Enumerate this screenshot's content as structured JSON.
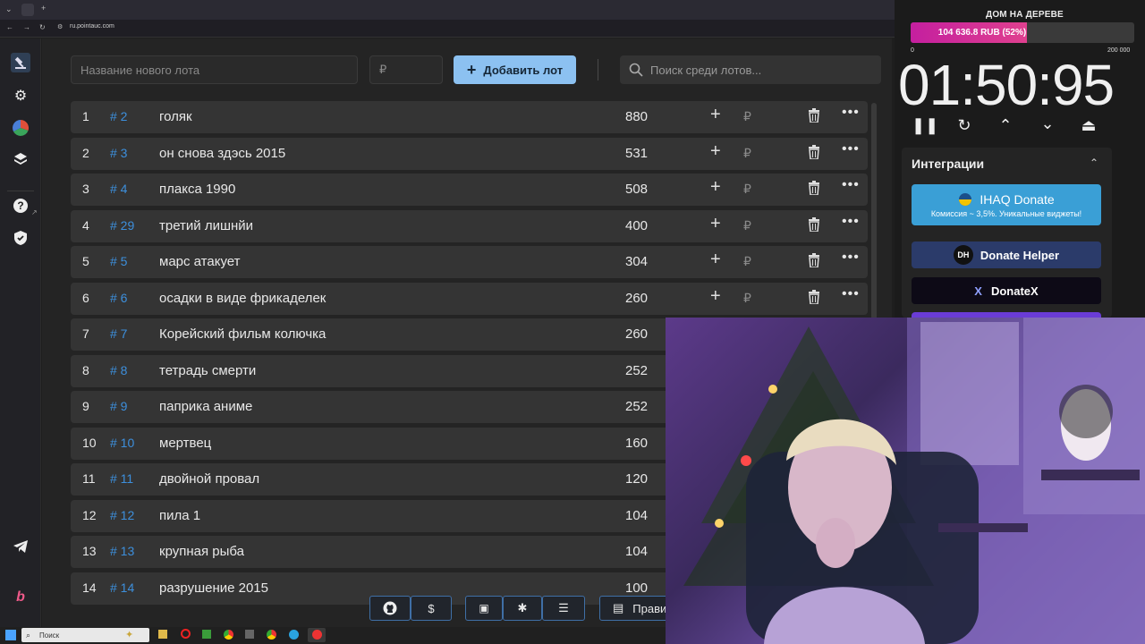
{
  "browser": {
    "url": "ru.pointauc.com"
  },
  "toolbar": {
    "new_lot_placeholder": "Название нового лота",
    "amount_placeholder": "₽",
    "add_button": "Добавить лот",
    "search_placeholder": "Поиск среди лотов..."
  },
  "lots": [
    {
      "n": "1",
      "id": "# 2",
      "name": "голяк",
      "amount": "880"
    },
    {
      "n": "2",
      "id": "# 3",
      "name": "он снова здэсь 2015",
      "amount": "531"
    },
    {
      "n": "3",
      "id": "# 4",
      "name": "плакса 1990",
      "amount": "508"
    },
    {
      "n": "4",
      "id": "# 29",
      "name": "третий лишнйи",
      "amount": "400"
    },
    {
      "n": "5",
      "id": "# 5",
      "name": "марс атакует",
      "amount": "304"
    },
    {
      "n": "6",
      "id": "# 6",
      "name": "осадки в виде фрикаделек",
      "amount": "260"
    },
    {
      "n": "7",
      "id": "# 7",
      "name": "Корейский фильм колючка",
      "amount": "260"
    },
    {
      "n": "8",
      "id": "# 8",
      "name": "тетрадь смерти",
      "amount": "252"
    },
    {
      "n": "9",
      "id": "# 9",
      "name": "паприка аниме",
      "amount": "252"
    },
    {
      "n": "10",
      "id": "# 10",
      "name": "мертвец",
      "amount": "160"
    },
    {
      "n": "11",
      "id": "# 11",
      "name": " двойной провал",
      "amount": "120"
    },
    {
      "n": "12",
      "id": "# 12",
      "name": "пила 1",
      "amount": "104"
    },
    {
      "n": "13",
      "id": "# 13",
      "name": "крупная рыба",
      "amount": "104"
    },
    {
      "n": "14",
      "id": "# 14",
      "name": "разрушение 2015",
      "amount": "100"
    }
  ],
  "row_actions": {
    "plus": "+",
    "rub": "₽",
    "more": "•••"
  },
  "bottom": {
    "rules_label": "Прави"
  },
  "goal": {
    "title": "ДОМ НА ДЕРЕВЕ",
    "progress_text": "104 636.8 RUB (52%)",
    "progress_fraction": 0.52,
    "scale_min": "0",
    "scale_max": "200 000",
    "fill_color": "#c41f9f"
  },
  "timer": {
    "value": "01:50:95"
  },
  "integrations": {
    "title": "Интеграции",
    "ihaq_title": "IHAQ Donate",
    "ihaq_sub": "Комиссия ~ 3,5%. Уникальные виджеты!",
    "donate_helper": "Donate Helper",
    "donate_helper_logo": "DH",
    "donatex": "DonateX",
    "donatex_logo": "X"
  },
  "taskbar": {
    "search_placeholder": "Поиск"
  },
  "colors": {
    "accent": "#8cc1f1",
    "lot_id": "#3d8fdc",
    "ihaq": "#3a9fd6"
  }
}
